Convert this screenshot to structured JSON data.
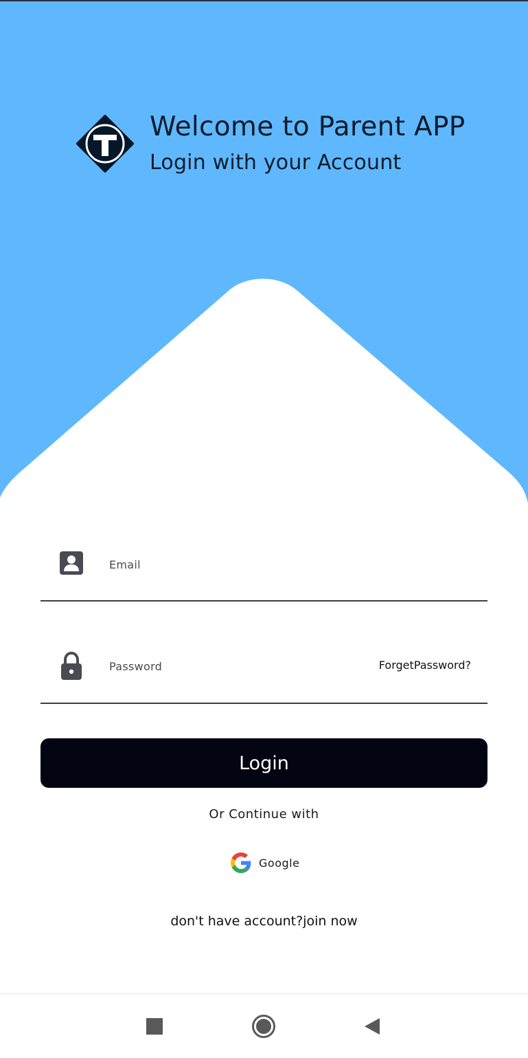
{
  "colors": {
    "hero_background": "#5fb8fe",
    "card_background": "#ffffff",
    "login_button": "#020412",
    "text_dark": "#0f1b2b"
  },
  "header": {
    "logo_icon": "t-diamond-logo",
    "title": "Welcome to Parent APP",
    "subtitle": "Login with your Account"
  },
  "form": {
    "email": {
      "icon": "account-box-icon",
      "placeholder": "Email",
      "value": ""
    },
    "password": {
      "icon": "lock-icon",
      "placeholder": "Password",
      "value": "",
      "forget_label": "ForgetPassword?"
    },
    "login_label": "Login",
    "or_continue_label": "Or Continue with",
    "google": {
      "icon": "google-icon",
      "label": "Google"
    }
  },
  "signup": {
    "prompt": "don't have account?",
    "join_label": "join now"
  },
  "navbar": {
    "items": [
      "recents-square-icon",
      "home-circle-icon",
      "back-triangle-icon"
    ]
  }
}
